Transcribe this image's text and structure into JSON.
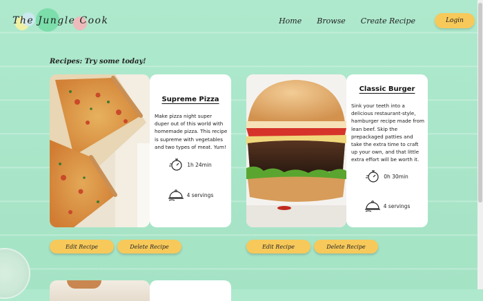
{
  "app": {
    "logo_text": "The Jungle Cook",
    "nav": [
      "Home",
      "Browse",
      "Create Recipe"
    ],
    "login_label": "Login"
  },
  "page": {
    "section_title": "Recipes: Try some today!"
  },
  "recipes": [
    {
      "title": "Supreme Pizza",
      "description": "Make pizza night super duper out of this world with homemade pizza. This recipe is supreme with vegetables and two types of meat. Yum!",
      "time": "1h 24min",
      "servings": "4 servings",
      "edit_label": "Edit Recipe",
      "delete_label": "Delete Recipe"
    },
    {
      "title": "Classic Burger",
      "description": "Sink your teeth into a delicious restaurant-style, hamburger recipe made from lean beef. Skip the prepackaged patties and take the extra time to craft up your own, and that little extra effort will be worth it.",
      "time": "0h 30min",
      "servings": "4 servings",
      "edit_label": "Edit Recipe",
      "delete_label": "Delete Recipe"
    }
  ],
  "colors": {
    "background": "#a8e6c8",
    "button": "#f7c95a",
    "card": "#ffffff"
  }
}
